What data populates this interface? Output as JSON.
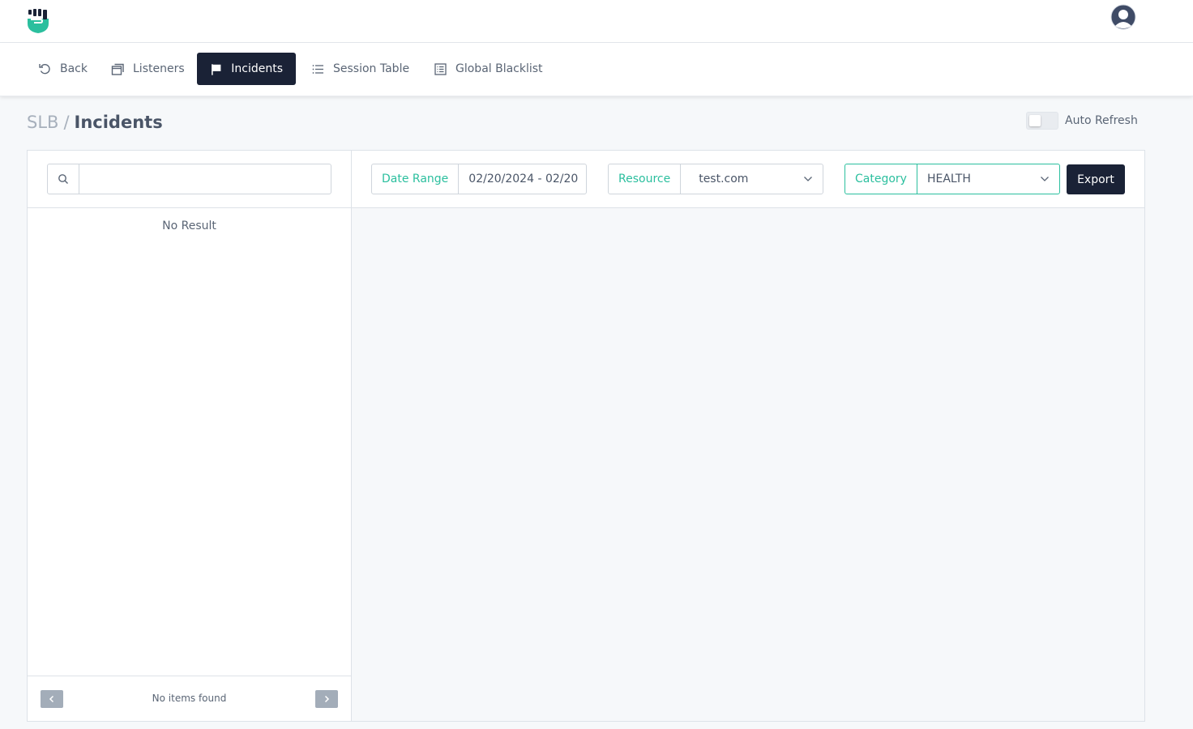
{
  "topbar": {
    "logo_icon": "fist-shield-logo-icon",
    "avatar_icon": "user-avatar-icon",
    "brand_color": "#2bbf9e"
  },
  "nav": {
    "items": [
      {
        "label": "Back",
        "icon": "undo-icon"
      },
      {
        "label": "Listeners",
        "icon": "windows-icon"
      },
      {
        "label": "Incidents",
        "icon": "flag-icon",
        "active": true
      },
      {
        "label": "Session Table",
        "icon": "list-icon"
      },
      {
        "label": "Global Blacklist",
        "icon": "table-list-icon"
      }
    ],
    "active_color": "#1a2236"
  },
  "breadcrumb": {
    "root": "SLB",
    "separator": "/",
    "current": "Incidents"
  },
  "auto_refresh": {
    "label": "Auto Refresh",
    "enabled": false
  },
  "left_panel": {
    "search": {
      "value": "",
      "placeholder": ""
    },
    "empty_text": "No Result",
    "pager": {
      "text": "No items found"
    }
  },
  "filters": {
    "date_range": {
      "label": "Date Range",
      "value": "02/20/2024 - 02/20"
    },
    "resource": {
      "label": "Resource",
      "value": "test.com"
    },
    "category": {
      "label": "Category",
      "value": "HEALTH"
    }
  },
  "export": {
    "label": "Export"
  }
}
